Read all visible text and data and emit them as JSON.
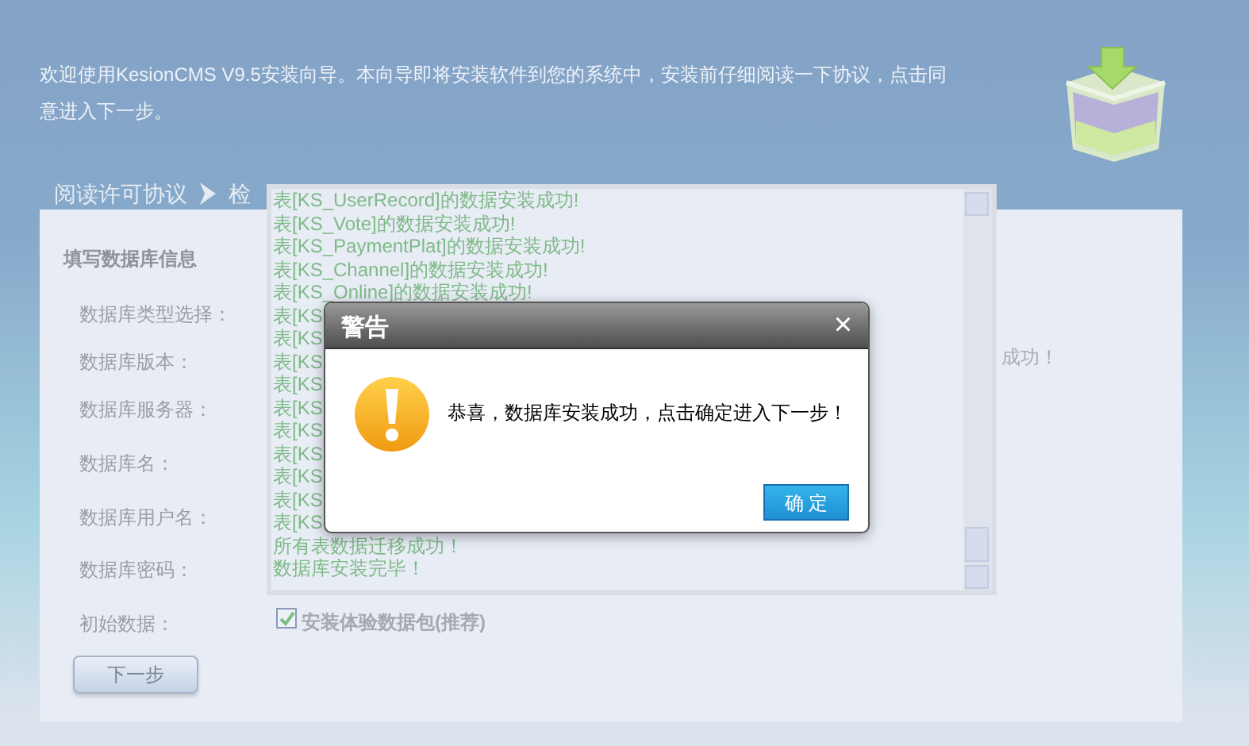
{
  "intro": "欢迎使用KesionCMS V9.5安装向导。本向导即将安装软件到您的系统中，安装前仔细阅读一下协议，点击同意进入下一步。",
  "steps": [
    "阅读许可协议",
    "检"
  ],
  "form": {
    "heading": "填写数据库信息",
    "fields": [
      "数据库类型选择：",
      "数据库版本：",
      "数据库服务器：",
      "数据库名：",
      "数据库用户名：",
      "数据库密码："
    ],
    "initial_data": {
      "label": "初始数据：",
      "checkbox": {
        "label": "安装体验数据包(推荐)",
        "checked": true
      }
    },
    "next_button": "下一步"
  },
  "partial_text": "成功！",
  "log": {
    "lines": [
      "表[KS_UserRecord]的数据安装成功!",
      "表[KS_Vote]的数据安装成功!",
      "表[KS_PaymentPlat]的数据安装成功!",
      "表[KS_Channel]的数据安装成功!",
      "表[KS_Online]的数据安装成功!",
      "表[KS",
      "表[KS",
      "表[KS",
      "表[KS",
      "表[KS",
      "表[KS",
      "表[KS",
      "表[KS",
      "表[KS",
      "表[KS",
      "所有表数据迁移成功！",
      "数据库安装完毕！"
    ]
  },
  "dialog": {
    "title": "警告",
    "close": "×",
    "message": "恭喜，数据库安装成功，点击确定进入下一步！",
    "ok_button": "确 定"
  }
}
